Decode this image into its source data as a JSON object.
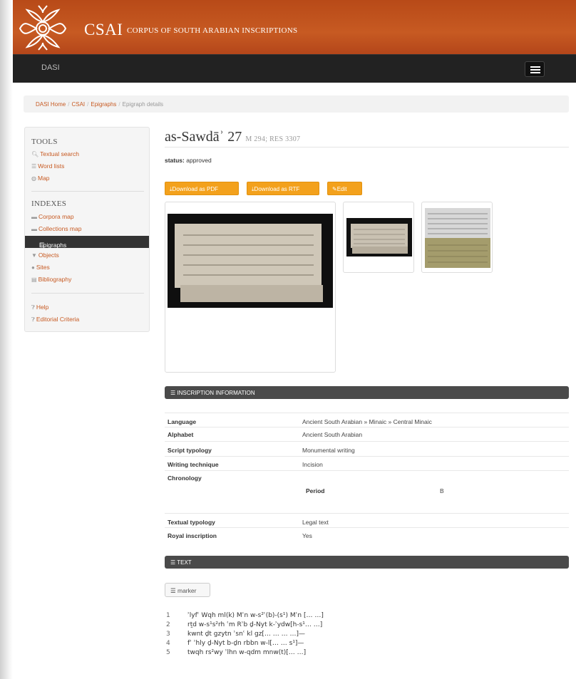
{
  "header": {
    "brand_title": "CSAI",
    "brand_subtitle": "CORPUS OF SOUTH ARABIAN INSCRIPTIONS",
    "nav_brand": "DASI",
    "menu_icon": "hamburger-icon",
    "colors": {
      "brand_bar": "#c75a22",
      "navbar": "#222222",
      "accent": "#f3a11c"
    }
  },
  "breadcrumb": {
    "items": [
      "DASI Home",
      "CSAI",
      "Epigraphs"
    ],
    "separator": "/",
    "current": "Epigraph details"
  },
  "sidebar": {
    "tools_heading": "TOOLS",
    "tools": [
      {
        "label": "Textual search",
        "icon": "search-icon"
      },
      {
        "label": "Word lists",
        "icon": "list-icon"
      },
      {
        "label": "Map",
        "icon": "globe-icon"
      }
    ],
    "indexes_heading": "INDEXES",
    "indexes": [
      {
        "label": "Corpora map",
        "icon": "folder-icon"
      },
      {
        "label": "Collections map",
        "icon": "folder-icon"
      },
      {
        "label": "Epigraphs",
        "icon": "list-icon",
        "active": true
      },
      {
        "label": "Objects",
        "icon": "filter-icon"
      },
      {
        "label": "Sites",
        "icon": "map-marker-icon"
      },
      {
        "label": "Bibliography",
        "icon": "book-icon"
      }
    ],
    "help": [
      {
        "label": "Help",
        "icon": "question-icon"
      },
      {
        "label": "Editorial Criteria",
        "icon": "question-icon"
      }
    ]
  },
  "main": {
    "title": "as-Sawdāʾ 27",
    "title_refs": "M 294; RES 3307",
    "status_label": "status:",
    "status_value": "approved",
    "buttons": {
      "pdf": "Download as PDF",
      "rtf": "Download as RTF",
      "edit": "Edit"
    },
    "inscription_panel_title": "INSCRIPTION INFORMATION",
    "info": {
      "language_label": "Language",
      "language_value": "Ancient South Arabian » Minaic » Central Minaic",
      "alphabet_label": "Alphabet",
      "alphabet_value": "Ancient South Arabian",
      "script_label": "Script typology",
      "script_value": "Monumental writing",
      "technique_label": "Writing technique",
      "technique_value": "Incision",
      "chronology_label": "Chronology",
      "period_label": "Period",
      "period_value": "B",
      "textual_label": "Textual typology",
      "textual_value": "Legal text",
      "royal_label": "Royal inscription",
      "royal_value": "Yes"
    },
    "text_panel_title": "TEXT",
    "marker_label": "marker",
    "text_lines": [
      {
        "n": "1",
        "t": "ʾlyfʿ Wqh ml(k) Mʿn w-s²ʿ(b)-(s¹) Mʿn [… …]"
      },
      {
        "n": "2",
        "t": "rṯd w-s¹s²rh ʿm Rʾb ḏ-Nyt k-ʾydw[h-s¹… …]"
      },
      {
        "n": "3",
        "t": "kwnt ḏt gzytn ʾsnʿ kl gz[… … … …]—"
      },
      {
        "n": "4",
        "t": "fʾ ʾhly ḏ-Nyt b-ḏn rbbn w-l[… … s¹]—"
      },
      {
        "n": "5",
        "t": "twqh rs²wy ʾlhn w-qdm mnw(t)[… …]"
      }
    ]
  }
}
